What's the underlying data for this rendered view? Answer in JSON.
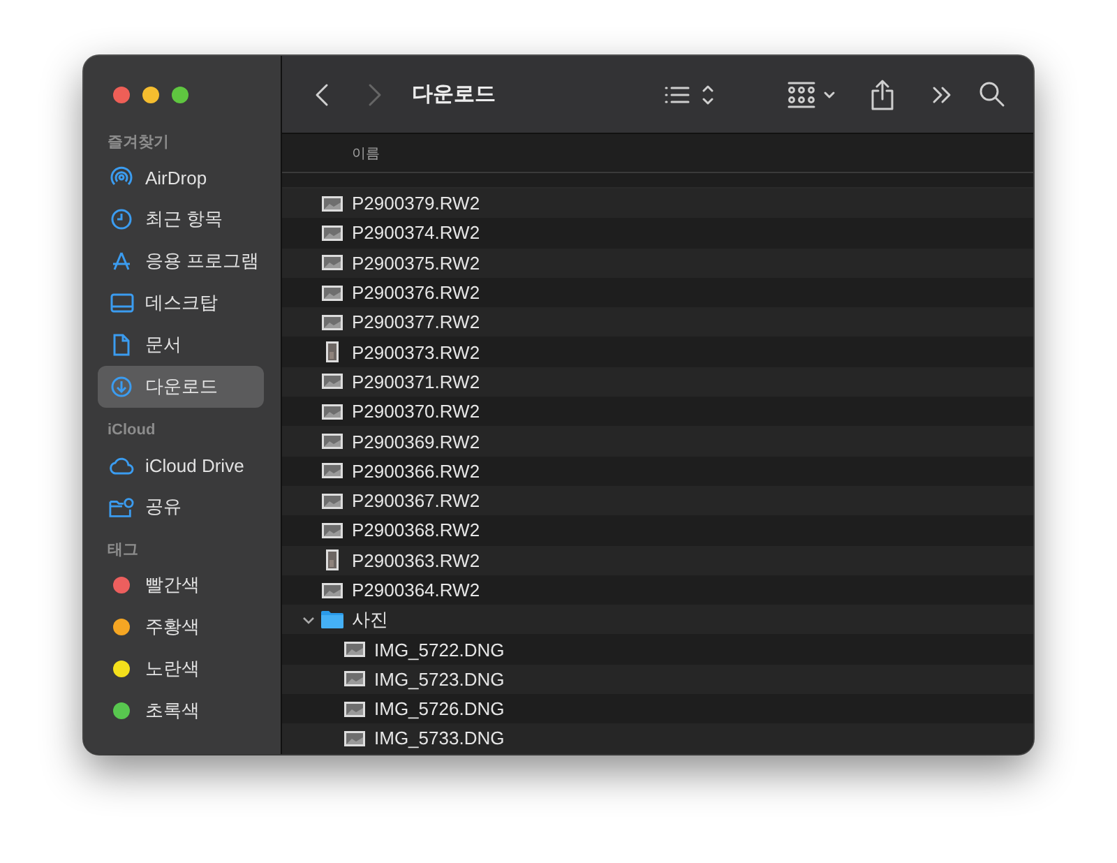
{
  "window": {
    "title": "다운로드"
  },
  "navigation": {
    "back_disabled": false,
    "forward_disabled": true
  },
  "sidebar": {
    "sections": [
      {
        "title": "즐겨찾기",
        "items": [
          {
            "kind": "airdrop",
            "label": "AirDrop",
            "selected": false
          },
          {
            "kind": "recents",
            "label": "최근 항목",
            "selected": false
          },
          {
            "kind": "apps",
            "label": "응용 프로그램",
            "selected": false
          },
          {
            "kind": "desktop",
            "label": "데스크탑",
            "selected": false
          },
          {
            "kind": "documents",
            "label": "문서",
            "selected": false
          },
          {
            "kind": "downloads",
            "label": "다운로드",
            "selected": true
          }
        ]
      },
      {
        "title": "iCloud",
        "items": [
          {
            "kind": "cloud",
            "label": "iCloud Drive",
            "selected": false
          },
          {
            "kind": "shared",
            "label": "공유",
            "selected": false
          }
        ]
      },
      {
        "title": "태그",
        "items": [
          {
            "kind": "tag",
            "label": "빨간색",
            "color": "#ec5f5e",
            "selected": false
          },
          {
            "kind": "tag",
            "label": "주황색",
            "color": "#f5a623",
            "selected": false
          },
          {
            "kind": "tag",
            "label": "노란색",
            "color": "#f4e01c",
            "selected": false
          },
          {
            "kind": "tag",
            "label": "초록색",
            "color": "#58c74f",
            "selected": false
          }
        ]
      }
    ]
  },
  "file_list": {
    "columns": [
      "이름"
    ],
    "rows": [
      {
        "kind": "file",
        "name": "P2900379.RW2",
        "portrait": false
      },
      {
        "kind": "file",
        "name": "P2900374.RW2",
        "portrait": false
      },
      {
        "kind": "file",
        "name": "P2900375.RW2",
        "portrait": false
      },
      {
        "kind": "file",
        "name": "P2900376.RW2",
        "portrait": false
      },
      {
        "kind": "file",
        "name": "P2900377.RW2",
        "portrait": false
      },
      {
        "kind": "file",
        "name": "P2900373.RW2",
        "portrait": true
      },
      {
        "kind": "file",
        "name": "P2900371.RW2",
        "portrait": false
      },
      {
        "kind": "file",
        "name": "P2900370.RW2",
        "portrait": false
      },
      {
        "kind": "file",
        "name": "P2900369.RW2",
        "portrait": false
      },
      {
        "kind": "file",
        "name": "P2900366.RW2",
        "portrait": false
      },
      {
        "kind": "file",
        "name": "P2900367.RW2",
        "portrait": false
      },
      {
        "kind": "file",
        "name": "P2900368.RW2",
        "portrait": false
      },
      {
        "kind": "file",
        "name": "P2900363.RW2",
        "portrait": true
      },
      {
        "kind": "file",
        "name": "P2900364.RW2",
        "portrait": false
      },
      {
        "kind": "folder",
        "name": "사진",
        "expanded": true,
        "children": [
          {
            "kind": "file",
            "name": "IMG_5722.DNG",
            "portrait": false
          },
          {
            "kind": "file",
            "name": "IMG_5723.DNG",
            "portrait": false
          },
          {
            "kind": "file",
            "name": "IMG_5726.DNG",
            "portrait": false
          },
          {
            "kind": "file",
            "name": "IMG_5733.DNG",
            "portrait": false
          }
        ]
      }
    ]
  }
}
